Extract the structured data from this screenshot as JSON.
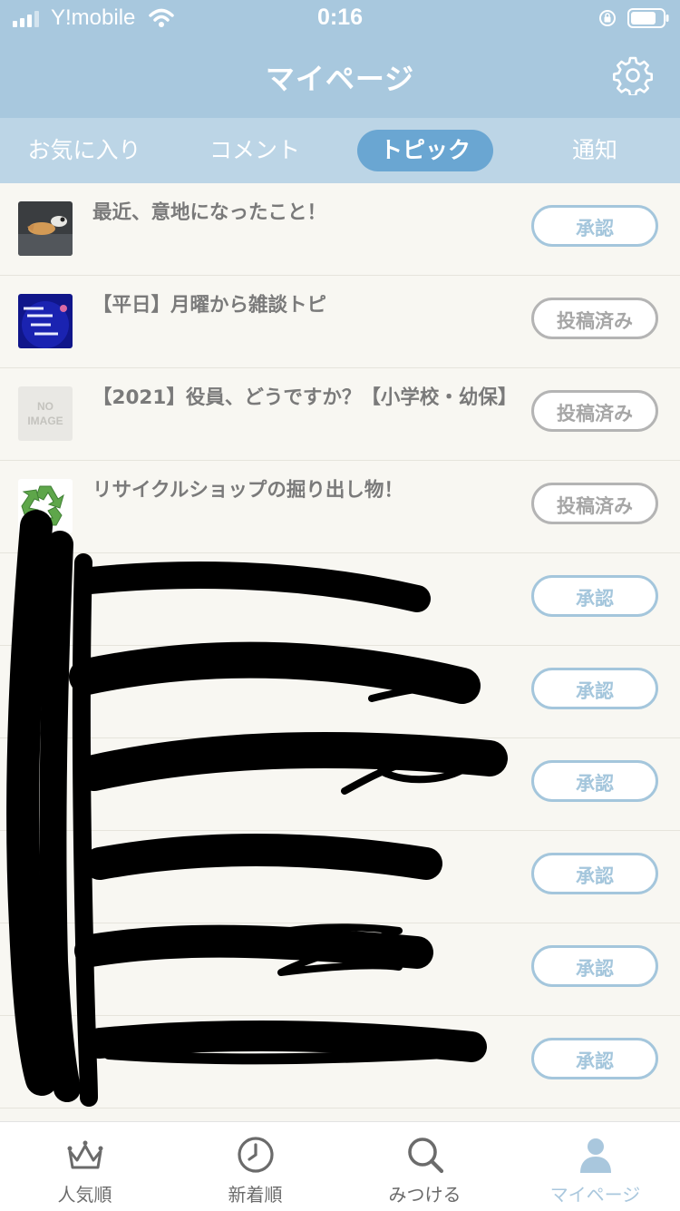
{
  "status_bar": {
    "carrier": "Y!mobile",
    "time": "0:16"
  },
  "header": {
    "title": "マイページ",
    "settings_icon": "gear-icon"
  },
  "tabs": [
    {
      "label": "お気に入り",
      "active": false
    },
    {
      "label": "コメント",
      "active": false
    },
    {
      "label": "トピック",
      "active": true
    },
    {
      "label": "通知",
      "active": false
    }
  ],
  "topics": [
    {
      "title": "最近、意地になったこと！",
      "status": "承認",
      "status_type": "approve",
      "thumb": "photo-dog"
    },
    {
      "title": "【平日】月曜から雑談トピ",
      "status": "投稿済み",
      "status_type": "posted",
      "thumb": "photo-night"
    },
    {
      "title": "【2021】役員、どうですか？【小学校・幼保】",
      "status": "投稿済み",
      "status_type": "posted",
      "thumb": "no-image",
      "thumb_text": "NO IMAGE"
    },
    {
      "title": "リサイクルショップの掘り出し物！",
      "status": "投稿済み",
      "status_type": "posted",
      "thumb": "recycle-icon"
    },
    {
      "title": "",
      "status": "承認",
      "status_type": "approve",
      "thumb": "redacted"
    },
    {
      "title": "",
      "status": "承認",
      "status_type": "approve",
      "thumb": "redacted"
    },
    {
      "title": "",
      "status": "承認",
      "status_type": "approve",
      "thumb": "redacted"
    },
    {
      "title": "",
      "status": "承認",
      "status_type": "approve",
      "thumb": "redacted"
    },
    {
      "title": "",
      "status": "承認",
      "status_type": "approve",
      "thumb": "redacted"
    },
    {
      "title": "",
      "status": "承認",
      "status_type": "approve",
      "thumb": "redacted"
    }
  ],
  "bottom_nav": [
    {
      "label": "人気順",
      "icon": "crown-icon",
      "active": false
    },
    {
      "label": "新着順",
      "icon": "clock-icon",
      "active": false
    },
    {
      "label": "みつける",
      "icon": "search-icon",
      "active": false
    },
    {
      "label": "マイページ",
      "icon": "person-icon",
      "active": true
    }
  ],
  "colors": {
    "header": "#a8c8de",
    "tab_bar": "#bcd5e6",
    "active_tab": "#6aa6d2",
    "approve": "#a4c6dc",
    "posted": "#b4b4b4"
  }
}
